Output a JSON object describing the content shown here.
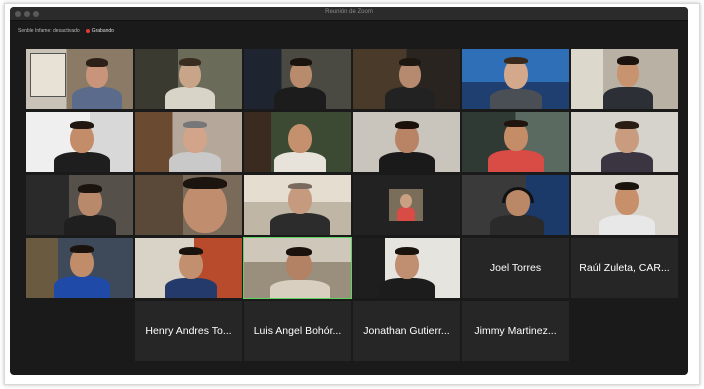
{
  "window": {
    "title": "Reunión de Zoom"
  },
  "infobar": {
    "view_label": "Senble Infame: desactivado",
    "recording_label": "Grabando"
  },
  "participants_named": [
    {
      "name": "Joel Torres"
    },
    {
      "name": "Raúl Zuleta, CAR..."
    },
    {
      "name": "Henry Andres To..."
    },
    {
      "name": "Luis Angel Bohór..."
    },
    {
      "name": "Jonathan Gutierr..."
    },
    {
      "name": "Jimmy Martinez..."
    }
  ],
  "colors": {
    "window_bg": "#1a1a1a",
    "tile_bg": "#2a2a2a",
    "active_speaker": "#5fd35f",
    "recording": "#e53935"
  }
}
